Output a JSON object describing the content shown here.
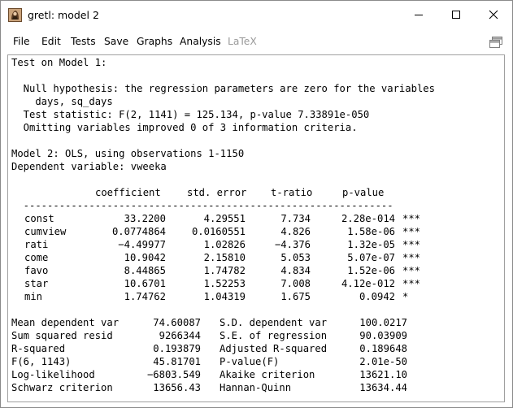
{
  "window": {
    "title": "gretl: model 2"
  },
  "menu": {
    "items": [
      {
        "label": "File",
        "enabled": true
      },
      {
        "label": "Edit",
        "enabled": true
      },
      {
        "label": "Tests",
        "enabled": true
      },
      {
        "label": "Save",
        "enabled": true
      },
      {
        "label": "Graphs",
        "enabled": true
      },
      {
        "label": "Analysis",
        "enabled": true
      },
      {
        "label": "LaTeX",
        "enabled": false
      }
    ]
  },
  "toolbar": {
    "icon": "copy-window-icon"
  },
  "output": {
    "test_header": "Test on Model 1:",
    "null_hypothesis_1": "  Null hypothesis: the regression parameters are zero for the variables",
    "null_hypothesis_2": "    days, sq_days",
    "test_statistic": "  Test statistic: F(2, 1141) = 125.134, p-value 7.33891e-050",
    "omitting": "  Omitting variables improved 0 of 3 information criteria.",
    "model_header": "Model 2: OLS, using observations 1-1150",
    "dependent": "Dependent variable: vweeka",
    "columns": {
      "coefficient": "coefficient",
      "std_error": "std. error",
      "t_ratio": "t-ratio",
      "p_value": "p-value"
    },
    "separator": "  --------------------------------------------------------------",
    "coefficients": [
      {
        "name": "const",
        "coef": "33.2200",
        "se": "4.29551",
        "t": "7.734",
        "p": "2.28e-014",
        "sig": "***"
      },
      {
        "name": "cumview",
        "coef": "0.0774864",
        "se": "0.0160551",
        "t": "4.826",
        "p": "1.58e-06",
        "sig": "***"
      },
      {
        "name": "rati",
        "coef": "−4.49977",
        "se": "1.02826",
        "t": "−4.376",
        "p": "1.32e-05",
        "sig": "***"
      },
      {
        "name": "come",
        "coef": "10.9042",
        "se": "2.15810",
        "t": "5.053",
        "p": "5.07e-07",
        "sig": "***"
      },
      {
        "name": "favo",
        "coef": "8.44865",
        "se": "1.74782",
        "t": "4.834",
        "p": "1.52e-06",
        "sig": "***"
      },
      {
        "name": "star",
        "coef": "10.6701",
        "se": "1.52253",
        "t": "7.008",
        "p": "4.12e-012",
        "sig": "***"
      },
      {
        "name": "min",
        "coef": "1.74762",
        "se": "1.04319",
        "t": "1.675",
        "p": "0.0942",
        "sig": "*"
      }
    ],
    "stats": [
      {
        "l_label": "Mean dependent var",
        "l_value": "74.60087",
        "r_label": "S.D. dependent var",
        "r_value": "100.0217"
      },
      {
        "l_label": "Sum squared resid",
        "l_value": "9266344",
        "r_label": "S.E. of regression",
        "r_value": "90.03909"
      },
      {
        "l_label": "R-squared",
        "l_value": "0.193879",
        "r_label": "Adjusted R-squared",
        "r_value": "0.189648"
      },
      {
        "l_label": "F(6, 1143)",
        "l_value": "45.81701",
        "r_label": "P-value(F)",
        "r_value": "2.01e-50"
      },
      {
        "l_label": "Log-likelihood",
        "l_value": "−6803.549",
        "r_label": "Akaike criterion",
        "r_value": "13621.10"
      },
      {
        "l_label": "Schwarz criterion",
        "l_value": "13656.43",
        "r_label": "Hannan-Quinn",
        "r_value": "13634.44"
      }
    ]
  }
}
